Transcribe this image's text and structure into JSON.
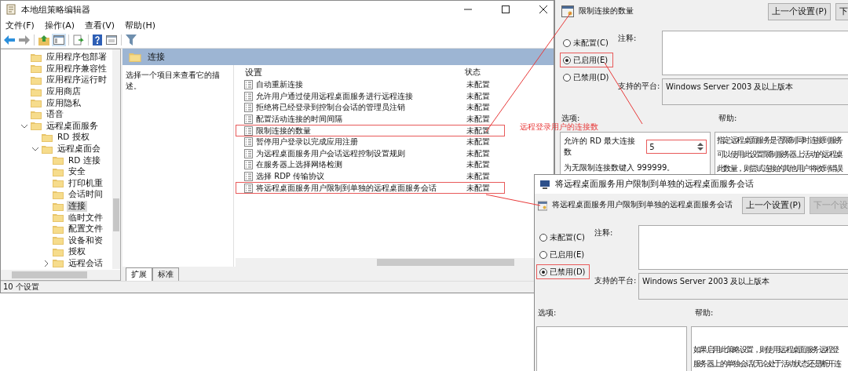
{
  "main_window": {
    "title": "本地组策略编辑器",
    "menu": [
      "文件(F)",
      "操作(A)",
      "查看(V)",
      "帮助(H)"
    ],
    "tree": [
      {
        "label": "应用程序包部署",
        "selected": false
      },
      {
        "label": "应用程序兼容性",
        "selected": false
      },
      {
        "label": "应用程序运行时",
        "selected": false
      },
      {
        "label": "应用商店",
        "selected": false
      },
      {
        "label": "应用隐私",
        "selected": false
      },
      {
        "label": "语音",
        "selected": false
      },
      {
        "label": "远程桌面服务",
        "selected": false,
        "expanded": true,
        "children": [
          {
            "label": "RD 授权",
            "selected": false
          },
          {
            "label": "远程桌面会",
            "selected": false,
            "expanded": true,
            "children": [
              {
                "label": "RD 连接",
                "selected": false
              },
              {
                "label": "安全",
                "selected": false
              },
              {
                "label": "打印机重",
                "selected": false
              },
              {
                "label": "会话时间",
                "selected": false
              },
              {
                "label": "连接",
                "selected": true
              },
              {
                "label": "临时文件",
                "selected": false
              },
              {
                "label": "配置文件",
                "selected": false
              },
              {
                "label": "设备和资",
                "selected": false
              },
              {
                "label": "授权",
                "selected": false
              },
              {
                "label": "远程会话",
                "selected": false,
                "expanded": false
              }
            ]
          }
        ]
      }
    ],
    "panel_title": "连接",
    "description": "选择一个项目来查看它的描述。",
    "columns": [
      "设置",
      "状态"
    ],
    "rows": [
      {
        "name": "自动重新连接",
        "state": "未配置",
        "highlighted": false
      },
      {
        "name": "允许用户通过使用远程桌面服务进行远程连接",
        "state": "未配置",
        "highlighted": false
      },
      {
        "name": "拒绝将已经登录到控制台会话的管理员注销",
        "state": "未配置",
        "highlighted": false
      },
      {
        "name": "配置活动连接的时间间隔",
        "state": "未配置",
        "highlighted": false
      },
      {
        "name": "限制连接的数量",
        "state": "未配置",
        "highlighted": true
      },
      {
        "name": "暂停用户登录以完成应用注册",
        "state": "未配置",
        "highlighted": false
      },
      {
        "name": "为远程桌面服务用户会话远程控制设置规则",
        "state": "未配置",
        "highlighted": false
      },
      {
        "name": "在服务器上选择网络检测",
        "state": "未配置",
        "highlighted": false
      },
      {
        "name": "选择 RDP 传输协议",
        "state": "未配置",
        "highlighted": false
      },
      {
        "name": "将远程桌面服务用户限制到单独的远程桌面服务会话",
        "state": "未配置",
        "highlighted": true
      }
    ],
    "tabs": [
      {
        "label": "扩展",
        "selected": true
      },
      {
        "label": "标准",
        "selected": false
      }
    ],
    "status_bar": "10 个设置"
  },
  "annotation": {
    "text": "远程登录用户的连接数"
  },
  "dialogs": [
    {
      "heading": "限制连接的数量",
      "buttons": [
        {
          "label": "上一个设置(P)",
          "disabled": false
        },
        {
          "label": "下",
          "disabled": false
        }
      ],
      "radios": [
        {
          "label": "未配置(C)",
          "selected": false,
          "highlighted": false
        },
        {
          "label": "已启用(E)",
          "selected": true,
          "highlighted": true
        },
        {
          "label": "已禁用(D)",
          "selected": false,
          "highlighted": false
        }
      ],
      "comment_label": "注释:",
      "platform_label": "支持的平台:",
      "platform": "Windows Server 2003 及以上版本",
      "options_label": "选项:",
      "help_label": "帮助:",
      "option": {
        "label": "允许的 RD 最大连接数",
        "value": "5",
        "highlighted": true,
        "note": "为无限制连接数键入 999999。"
      },
      "help": [
        "指定远程桌面服务是否限制同时连接到服务",
        "可以使用此设置限制服务器上活动的远程桌",
        "此数量，则尝试连接的其他用户将收到错误"
      ]
    },
    {
      "title": "将远程桌面服务用户限制到单独的远程桌面服务会话",
      "heading": "将远程桌面服务用户限制到单独的远程桌面服务会话",
      "buttons": [
        {
          "label": "上一个设置(P)",
          "disabled": false
        },
        {
          "label": "下一个设",
          "disabled": true
        }
      ],
      "radios": [
        {
          "label": "未配置(C)",
          "selected": false,
          "highlighted": false
        },
        {
          "label": "已启用(E)",
          "selected": false,
          "highlighted": false
        },
        {
          "label": "已禁用(D)",
          "selected": true,
          "highlighted": true
        }
      ],
      "comment_label": "注释:",
      "platform_label": "支持的平台:",
      "platform": "Windows Server 2003 及以上版本",
      "options_label": "选项:",
      "help_label": "帮助:",
      "help": [
        "如果启用此策略设置，则使用远程桌面服务远程登",
        "服务器上的单独会话(无论处于活动状态还是断开连"
      ]
    }
  ]
}
